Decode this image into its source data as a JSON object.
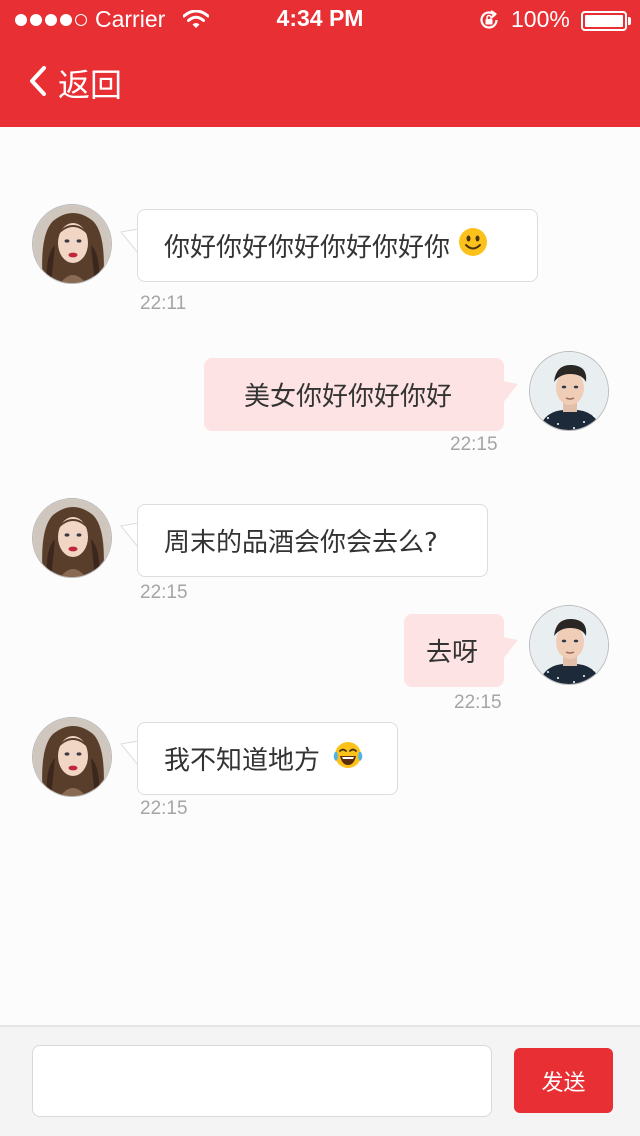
{
  "status_bar": {
    "carrier": "Carrier",
    "time": "4:34 PM",
    "battery": "100%"
  },
  "nav": {
    "back_label": "返回"
  },
  "messages": [
    {
      "side": "incoming",
      "text": "你好你好你好你好你好你",
      "emoji": "slightly-smiling-face",
      "time": "22:11"
    },
    {
      "side": "outgoing",
      "text": "美女你好你好你好",
      "time": "22:15"
    },
    {
      "side": "incoming",
      "text": "周末的品酒会你会去么?",
      "time": "22:15"
    },
    {
      "side": "outgoing",
      "text": "去呀",
      "time": "22:15"
    },
    {
      "side": "incoming",
      "text": "我不知道地方",
      "emoji": "tears-of-joy-face",
      "time": "22:15"
    }
  ],
  "input": {
    "value": "",
    "placeholder": "",
    "send_label": "发送"
  },
  "colors": {
    "brand_red": "#e82f33",
    "outgoing_bubble": "#fde3e3",
    "incoming_bubble": "#ffffff",
    "timestamp": "#a5a5a5"
  }
}
